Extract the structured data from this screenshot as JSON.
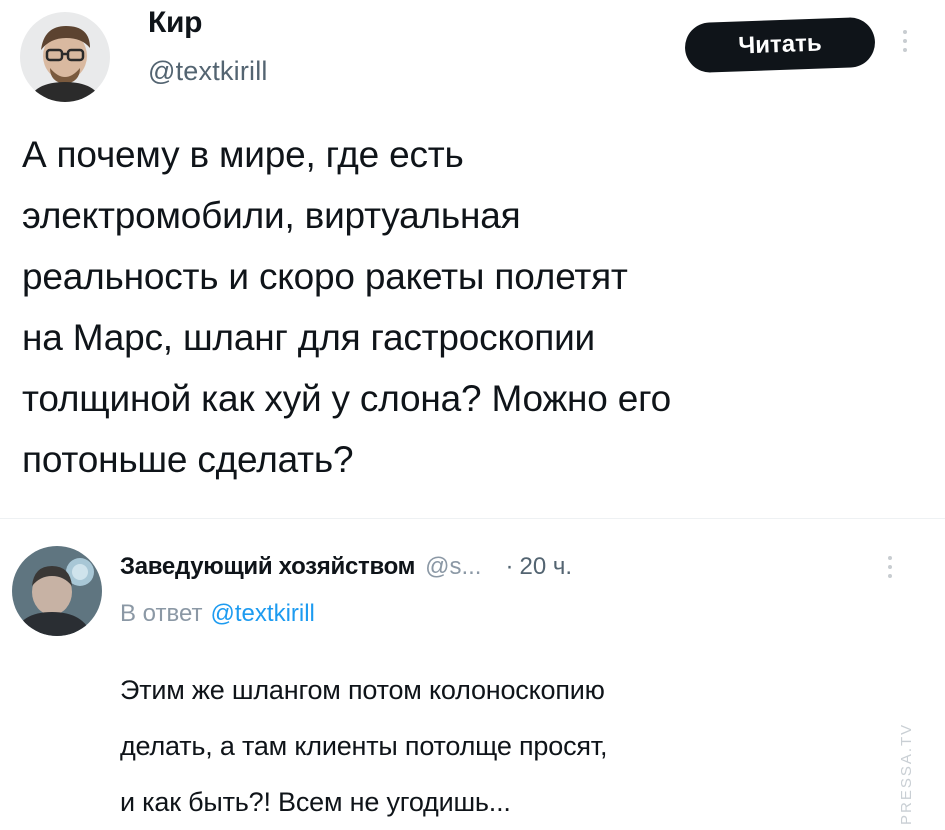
{
  "main_tweet": {
    "author_name": "Кир",
    "author_handle": "@textkirill",
    "follow_label": "Читать",
    "text_lines": [
      "А почему в мире, где есть",
      "электромобили, виртуальная",
      "реальность и скоро ракеты полетят",
      "на Марс, шланг для гастроскопии",
      "толщиной как хуй у слона? Можно его",
      "потоньше сделать?"
    ]
  },
  "reply_tweet": {
    "author_name": "Заведующий хозяйством",
    "author_handle": "@s...",
    "separator": "·",
    "time": "20 ч.",
    "reply_prefix": "В ответ",
    "reply_mention": "@textkirill",
    "text_lines": [
      "Этим же шлангом потом колоноскопию",
      "делать, а там клиенты потолще просят,",
      "и как быть?! Всем не угодишь..."
    ]
  },
  "watermark": "PRESSA.TV",
  "icons": {
    "main_more": "more-vertical-icon",
    "reply_more": "more-vertical-icon"
  },
  "colors": {
    "text": "#0f1419",
    "secondary": "#536471",
    "mention": "#1d9bf0",
    "button_bg": "#0f1419",
    "button_text": "#ffffff"
  }
}
